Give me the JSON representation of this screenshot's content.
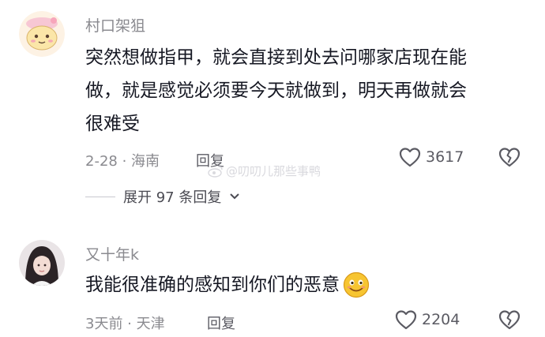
{
  "comments": [
    {
      "username": "村口架狙",
      "avatar_icon": "cartoon-cat-avatar",
      "lines": [
        "突然想做指甲，就会直接到处去问哪家店现在能",
        "做，就是感觉必须要今天就做到，明天再做就会",
        "很难受"
      ],
      "meta": "2-28 · 海南",
      "reply_label": "回复",
      "like_count": "3617",
      "expand_label": "展开 97 条回复"
    },
    {
      "username": "又十年k",
      "avatar_icon": "girl-photo-avatar",
      "lines": [
        "我能很准确的感知到你们的恶意"
      ],
      "emoji": "smiling-face-emoji",
      "meta": "3天前 · 天津",
      "reply_label": "回复",
      "like_count": "2204"
    }
  ],
  "watermark": {
    "text": "@叨叨儿那些事鸭",
    "icon": "weibo-logo-icon"
  },
  "colors": {
    "meta": "#8a8a8f",
    "content": "#161823",
    "emoji_yellow": "#f7c531"
  }
}
